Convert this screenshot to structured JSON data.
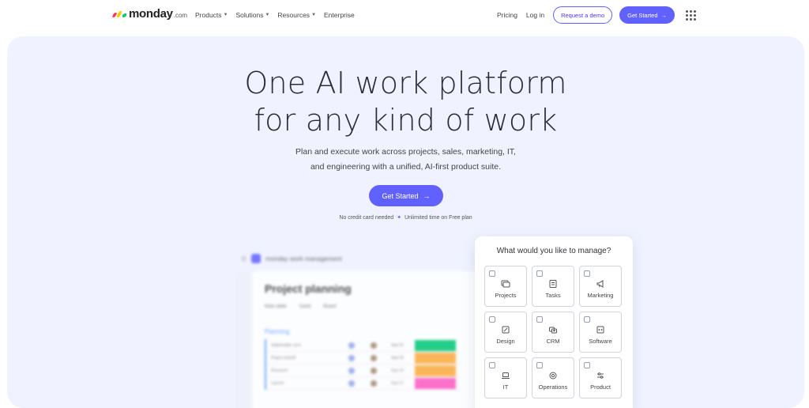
{
  "nav": {
    "logo_word": "monday",
    "logo_suffix": ".com",
    "logo_colors": [
      "#ff3d57",
      "#ffcb00",
      "#00ca72"
    ],
    "menu": [
      {
        "label": "Products",
        "has_dropdown": true
      },
      {
        "label": "Solutions",
        "has_dropdown": true
      },
      {
        "label": "Resources",
        "has_dropdown": true
      },
      {
        "label": "Enterprise",
        "has_dropdown": false
      }
    ],
    "pricing": "Pricing",
    "login": "Log in",
    "demo": "Request a demo",
    "get_started": "Get Started",
    "apps_icon": "grid-dots-icon"
  },
  "hero": {
    "title_line1": "One AI work platform",
    "title_line2": "for any kind of work",
    "subtitle_line1": "Plan and execute work across projects, sales, marketing, IT,",
    "subtitle_line2": "and engineering with a unified, AI-first product suite.",
    "cta": "Get Started",
    "note_left": "No credit card needed",
    "note_right": "Unlimited time on Free plan",
    "accent": "#6161ff",
    "background": "#f0f3ff"
  },
  "preview": {
    "product": "monday work management",
    "board_title": "Project planning",
    "tabs": [
      "Main table",
      "Gantt",
      "Board"
    ],
    "group": "Planning",
    "rows": [
      {
        "name": "Stakeholder sync",
        "date": "Sep 02",
        "status_color": "#00c875"
      },
      {
        "name": "Project kickoff",
        "date": "Sep 05",
        "status_color": "#fdab3d"
      },
      {
        "name": "Research",
        "date": "Sep 10",
        "status_color": "#fdab3d"
      },
      {
        "name": "Launch",
        "date": "Sep 17",
        "status_color": "#ff5ac4"
      }
    ]
  },
  "manage": {
    "title": "What would you like to manage?",
    "options": [
      {
        "label": "Projects",
        "icon": "projects-icon"
      },
      {
        "label": "Tasks",
        "icon": "tasks-icon"
      },
      {
        "label": "Marketing",
        "icon": "megaphone-icon"
      },
      {
        "label": "Design",
        "icon": "design-icon"
      },
      {
        "label": "CRM",
        "icon": "crm-icon"
      },
      {
        "label": "Software",
        "icon": "code-icon"
      },
      {
        "label": "IT",
        "icon": "laptop-icon"
      },
      {
        "label": "Operations",
        "icon": "gear-icon"
      },
      {
        "label": "Product",
        "icon": "sliders-icon"
      }
    ]
  }
}
